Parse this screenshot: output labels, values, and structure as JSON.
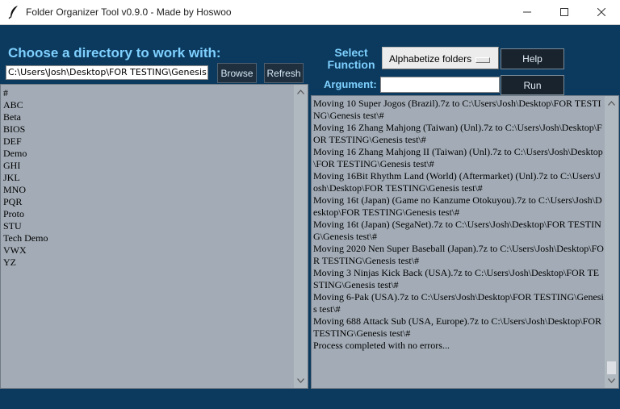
{
  "window": {
    "title": "Folder Organizer Tool v0.9.0 - Made by Hoswoo",
    "app_icon": "feather-icon",
    "controls": [
      "minimize-icon",
      "maximize-icon",
      "close-icon"
    ]
  },
  "directory": {
    "heading": "Choose a directory to work with:",
    "path_value": "C:\\Users\\Josh\\Desktop\\FOR TESTING\\Genesis t",
    "browse_label": "Browse",
    "refresh_label": "Refresh"
  },
  "function": {
    "select_label": "Select Function",
    "selected": "Alphabetize folders",
    "help_label": "Help",
    "argument_label": "Argument:",
    "argument_value": "",
    "run_label": "Run"
  },
  "folders": [
    "#",
    "ABC",
    "Beta",
    "BIOS",
    "DEF",
    "Demo",
    "GHI",
    "JKL",
    "MNO",
    "PQR",
    "Proto",
    "STU",
    "Tech Demo",
    "VWX",
    "YZ"
  ],
  "log": [
    "Moving 10 Super Jogos (Brazil).7z to C:\\Users\\Josh\\Desktop\\FOR TESTING\\Genesis test\\#",
    "Moving 16 Zhang Mahjong (Taiwan) (Unl).7z to C:\\Users\\Josh\\Desktop\\FOR TESTING\\Genesis test\\#",
    "Moving 16 Zhang Mahjong II (Taiwan) (Unl).7z to C:\\Users\\Josh\\Desktop\\FOR TESTING\\Genesis test\\#",
    "Moving 16Bit Rhythm Land (World) (Aftermarket) (Unl).7z to C:\\Users\\Josh\\Desktop\\FOR TESTING\\Genesis test\\#",
    "Moving 16t (Japan) (Game no Kanzume Otokuyou).7z to C:\\Users\\Josh\\Desktop\\FOR TESTING\\Genesis test\\#",
    "Moving 16t (Japan) (SegaNet).7z to C:\\Users\\Josh\\Desktop\\FOR TESTING\\Genesis test\\#",
    "Moving 2020 Nen Super Baseball (Japan).7z to C:\\Users\\Josh\\Desktop\\FOR TESTING\\Genesis test\\#",
    "Moving 3 Ninjas Kick Back (USA).7z to C:\\Users\\Josh\\Desktop\\FOR TESTING\\Genesis test\\#",
    "Moving 6-Pak (USA).7z to C:\\Users\\Josh\\Desktop\\FOR TESTING\\Genesis test\\#",
    "Moving 688 Attack Sub (USA, Europe).7z to C:\\Users\\Josh\\Desktop\\FOR TESTING\\Genesis test\\#",
    "Process completed with no errors..."
  ]
}
